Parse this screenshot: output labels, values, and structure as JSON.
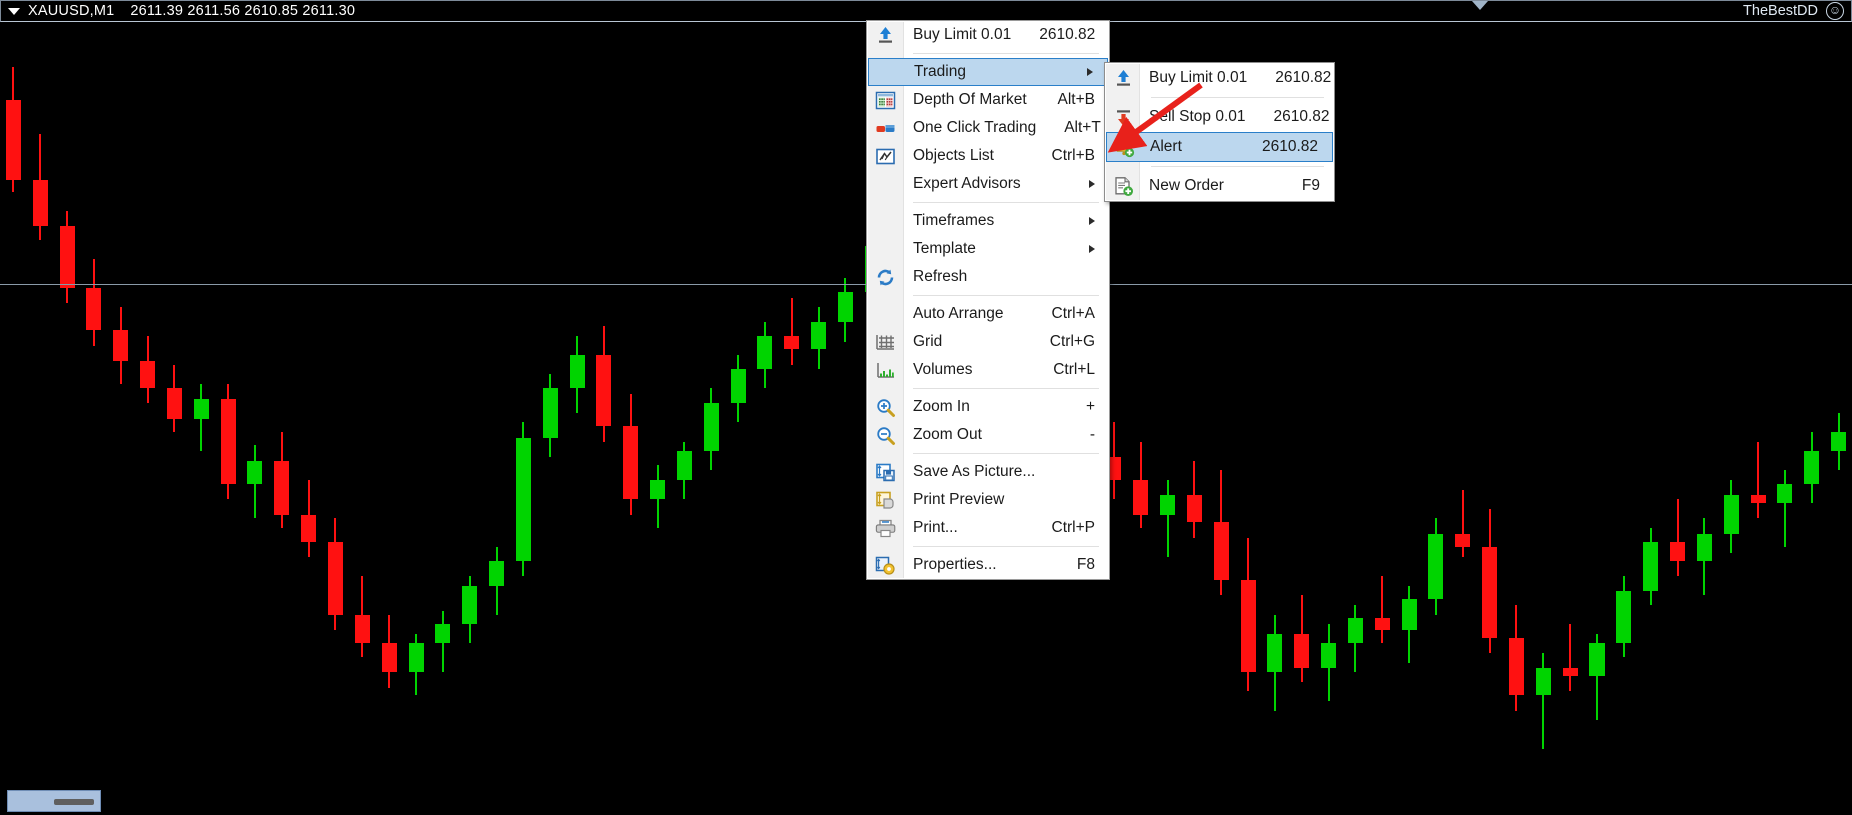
{
  "window": {
    "symbol": "XAUUSD,M1",
    "ohlc": "2611.39 2611.56 2610.85 2611.30",
    "account": "TheBestDD",
    "smiley_icon": "smiley-face-icon",
    "dropdown_icon": "triangle-down-icon",
    "collapse_icon": "chevron-down-icon"
  },
  "context_menu": {
    "items": [
      {
        "label": "Buy Limit 0.01",
        "value": "2610.82",
        "icon": "buy-arrow-up-icon",
        "selected": false,
        "submenu": false
      },
      {
        "separator": true
      },
      {
        "label": "Trading",
        "value": "",
        "icon": "",
        "selected": true,
        "submenu": true
      },
      {
        "label": "Depth Of Market",
        "value": "Alt+B",
        "icon": "depth-of-market-icon",
        "selected": false,
        "submenu": false
      },
      {
        "label": "One Click Trading",
        "value": "Alt+T",
        "icon": "one-click-trading-icon",
        "selected": false,
        "submenu": false
      },
      {
        "label": "Objects List",
        "value": "Ctrl+B",
        "icon": "objects-list-icon",
        "selected": false,
        "submenu": false
      },
      {
        "label": "Expert Advisors",
        "value": "",
        "icon": "",
        "selected": false,
        "submenu": true
      },
      {
        "separator": true
      },
      {
        "label": "Timeframes",
        "value": "",
        "icon": "",
        "selected": false,
        "submenu": true
      },
      {
        "label": "Template",
        "value": "",
        "icon": "",
        "selected": false,
        "submenu": true
      },
      {
        "label": "Refresh",
        "value": "",
        "icon": "refresh-icon",
        "selected": false,
        "submenu": false
      },
      {
        "separator": true
      },
      {
        "label": "Auto Arrange",
        "value": "Ctrl+A",
        "icon": "",
        "selected": false,
        "submenu": false
      },
      {
        "label": "Grid",
        "value": "Ctrl+G",
        "icon": "grid-icon",
        "selected": false,
        "submenu": false
      },
      {
        "label": "Volumes",
        "value": "Ctrl+L",
        "icon": "volumes-icon",
        "selected": false,
        "submenu": false
      },
      {
        "separator": true
      },
      {
        "label": "Zoom In",
        "value": "+",
        "icon": "zoom-in-icon",
        "selected": false,
        "submenu": false
      },
      {
        "label": "Zoom Out",
        "value": "-",
        "icon": "zoom-out-icon",
        "selected": false,
        "submenu": false
      },
      {
        "separator": true
      },
      {
        "label": "Save As Picture...",
        "value": "",
        "icon": "save-as-picture-icon",
        "selected": false,
        "submenu": false
      },
      {
        "label": "Print Preview",
        "value": "",
        "icon": "print-preview-icon",
        "selected": false,
        "submenu": false
      },
      {
        "label": "Print...",
        "value": "Ctrl+P",
        "icon": "print-icon",
        "selected": false,
        "submenu": false
      },
      {
        "separator": true
      },
      {
        "label": "Properties...",
        "value": "F8",
        "icon": "properties-icon",
        "selected": false,
        "submenu": false
      }
    ]
  },
  "trading_submenu": {
    "items": [
      {
        "label": "Buy Limit 0.01",
        "value": "2610.82",
        "icon": "buy-arrow-up-icon",
        "selected": false
      },
      {
        "separator": true
      },
      {
        "label": "Sell Stop 0.01",
        "value": "2610.82",
        "icon": "sell-arrow-down-icon",
        "selected": false
      },
      {
        "label": "Alert",
        "value": "2610.82",
        "icon": "alert-bell-icon",
        "selected": true
      },
      {
        "separator": true
      },
      {
        "label": "New Order",
        "value": "F9",
        "icon": "new-order-icon",
        "selected": false
      }
    ]
  },
  "colors": {
    "background": "#000000",
    "bull_candle": "#00D400",
    "bear_candle": "#FF1111",
    "price_line": "#8A9AA8",
    "menu_highlight": "#BCD7EE",
    "menu_highlight_border": "#2A7FC9",
    "annotation_arrow": "#E8211B",
    "text": "#FFFFFF"
  },
  "chart_data": {
    "type": "candlestick",
    "title": "XAUUSD,M1",
    "ohlc_readout": {
      "open": 2611.39,
      "high": 2611.56,
      "low": 2610.85,
      "close": 2611.3
    },
    "price_level_line": 2610.82,
    "xlabel": "",
    "ylabel": "",
    "grid": false,
    "legend": "none",
    "candles": [
      [
        2611.78,
        2611.95,
        2611.3,
        2611.36
      ],
      [
        2611.36,
        2611.6,
        2611.05,
        2611.12
      ],
      [
        2611.12,
        2611.2,
        2610.72,
        2610.8
      ],
      [
        2610.8,
        2610.95,
        2610.5,
        2610.58
      ],
      [
        2610.58,
        2610.7,
        2610.3,
        2610.42
      ],
      [
        2610.42,
        2610.55,
        2610.2,
        2610.28
      ],
      [
        2610.28,
        2610.4,
        2610.05,
        2610.12
      ],
      [
        2610.12,
        2610.3,
        2609.95,
        2610.22
      ],
      [
        2610.22,
        2610.3,
        2609.7,
        2609.78
      ],
      [
        2609.78,
        2609.98,
        2609.6,
        2609.9
      ],
      [
        2609.9,
        2610.05,
        2609.55,
        2609.62
      ],
      [
        2609.62,
        2609.8,
        2609.4,
        2609.48
      ],
      [
        2609.48,
        2609.6,
        2609.02,
        2609.1
      ],
      [
        2609.1,
        2609.3,
        2608.88,
        2608.95
      ],
      [
        2608.95,
        2609.1,
        2608.72,
        2608.8
      ],
      [
        2608.8,
        2609.0,
        2608.68,
        2608.95
      ],
      [
        2608.95,
        2609.12,
        2608.8,
        2609.05
      ],
      [
        2609.05,
        2609.3,
        2608.95,
        2609.25
      ],
      [
        2609.25,
        2609.45,
        2609.1,
        2609.38
      ],
      [
        2609.38,
        2610.1,
        2609.3,
        2610.02
      ],
      [
        2610.02,
        2610.35,
        2609.92,
        2610.28
      ],
      [
        2610.28,
        2610.55,
        2610.15,
        2610.45
      ],
      [
        2610.45,
        2610.6,
        2610.0,
        2610.08
      ],
      [
        2610.08,
        2610.25,
        2609.62,
        2609.7
      ],
      [
        2609.7,
        2609.88,
        2609.55,
        2609.8
      ],
      [
        2609.8,
        2610.0,
        2609.7,
        2609.95
      ],
      [
        2609.95,
        2610.28,
        2609.85,
        2610.2
      ],
      [
        2610.2,
        2610.45,
        2610.1,
        2610.38
      ],
      [
        2610.38,
        2610.62,
        2610.28,
        2610.55
      ],
      [
        2610.55,
        2610.75,
        2610.4,
        2610.48
      ],
      [
        2610.48,
        2610.7,
        2610.38,
        2610.62
      ],
      [
        2610.62,
        2610.85,
        2610.52,
        2610.78
      ],
      [
        2610.78,
        2611.1,
        2610.7,
        2611.02
      ],
      [
        2611.02,
        2611.35,
        2610.95,
        2611.28
      ],
      [
        2611.28,
        2611.42,
        2611.18,
        2611.35
      ],
      [
        2611.35,
        2611.6,
        2611.25,
        2611.52
      ],
      [
        2611.52,
        2611.58,
        2611.05,
        2611.12
      ],
      [
        2611.12,
        2611.25,
        2610.78,
        2610.85
      ],
      [
        2610.85,
        2610.98,
        2610.45,
        2610.52
      ],
      [
        2610.52,
        2610.68,
        2610.25,
        2610.32
      ],
      [
        2610.32,
        2610.48,
        2609.85,
        2609.92
      ],
      [
        2609.92,
        2610.1,
        2609.7,
        2609.8
      ],
      [
        2609.8,
        2610.0,
        2609.55,
        2609.62
      ],
      [
        2609.62,
        2609.8,
        2609.4,
        2609.72
      ],
      [
        2609.72,
        2609.9,
        2609.5,
        2609.58
      ],
      [
        2609.58,
        2609.85,
        2609.2,
        2609.28
      ],
      [
        2609.28,
        2609.5,
        2608.7,
        2608.8
      ],
      [
        2608.8,
        2609.1,
        2608.6,
        2609.0
      ],
      [
        2609.0,
        2609.2,
        2608.75,
        2608.82
      ],
      [
        2608.82,
        2609.05,
        2608.65,
        2608.95
      ],
      [
        2608.95,
        2609.15,
        2608.8,
        2609.08
      ],
      [
        2609.08,
        2609.3,
        2608.95,
        2609.02
      ],
      [
        2609.02,
        2609.25,
        2608.85,
        2609.18
      ],
      [
        2609.18,
        2609.6,
        2609.1,
        2609.52
      ],
      [
        2609.52,
        2609.75,
        2609.4,
        2609.45
      ],
      [
        2609.45,
        2609.65,
        2608.9,
        2608.98
      ],
      [
        2608.98,
        2609.15,
        2608.6,
        2608.68
      ],
      [
        2608.68,
        2608.9,
        2608.4,
        2608.82
      ],
      [
        2608.82,
        2609.05,
        2608.7,
        2608.78
      ],
      [
        2608.78,
        2609.0,
        2608.55,
        2608.95
      ],
      [
        2608.95,
        2609.3,
        2608.88,
        2609.22
      ],
      [
        2609.22,
        2609.55,
        2609.15,
        2609.48
      ],
      [
        2609.48,
        2609.7,
        2609.3,
        2609.38
      ],
      [
        2609.38,
        2609.6,
        2609.2,
        2609.52
      ],
      [
        2609.52,
        2609.8,
        2609.42,
        2609.72
      ],
      [
        2609.72,
        2610.0,
        2609.6,
        2609.68
      ],
      [
        2609.68,
        2609.85,
        2609.45,
        2609.78
      ],
      [
        2609.78,
        2610.05,
        2609.68,
        2609.95
      ],
      [
        2609.95,
        2610.15,
        2609.85,
        2610.05
      ]
    ]
  }
}
